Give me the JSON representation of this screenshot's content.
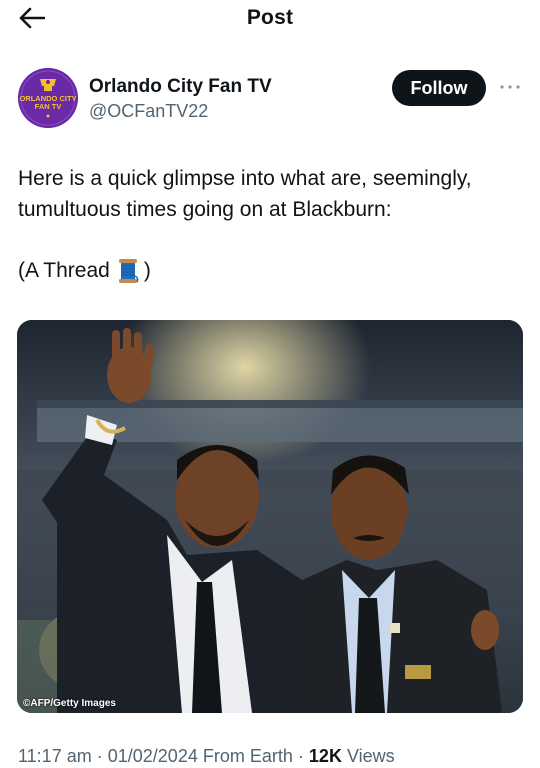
{
  "header": {
    "title": "Post",
    "back_icon": "arrow-left-icon"
  },
  "author": {
    "display_name": "Orlando City Fan TV",
    "handle": "@OCFanTV22",
    "avatar_text_1": "ORLANDO CITY",
    "avatar_text_2": "FAN TV",
    "follow_label": "Follow",
    "more_icon": "more-horizontal-icon"
  },
  "tweet": {
    "line1": "Here is a quick glimpse into what are, seemingly,",
    "line2": "tumultuous times going on at Blackburn:",
    "thread_prefix": "(A Thread",
    "thread_suffix": ")",
    "thread_emoji_icon": "thread-spool-icon"
  },
  "media": {
    "credit": "©AFP/Getty Images"
  },
  "meta": {
    "time": "11:17 am",
    "separator": "·",
    "date": "01/02/2024",
    "source": "From Earth",
    "views_count": "12K",
    "views_label": "Views"
  },
  "colors": {
    "text": "#0f1419",
    "secondary": "#536471",
    "follow_bg": "#0f1419",
    "avatar_purple": "#6a2aa6",
    "avatar_gold": "#f2c12e"
  }
}
